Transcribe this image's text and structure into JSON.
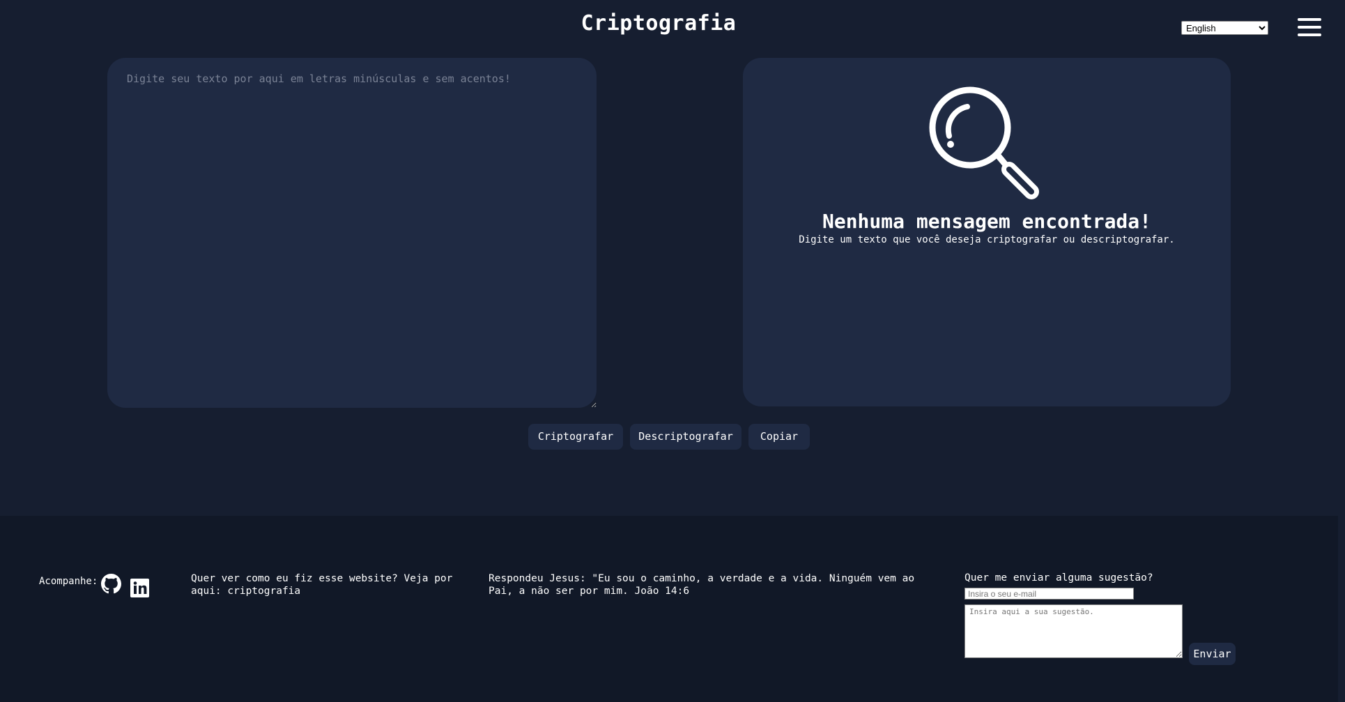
{
  "header": {
    "title": "Criptografia",
    "language_selected": "English",
    "language_options": [
      "English"
    ],
    "menu_icon": "hamburger-menu-icon"
  },
  "input": {
    "placeholder": "Digite seu texto por aqui em letras minúsculas e sem acentos!",
    "value": ""
  },
  "output": {
    "icon": "magnifier-icon",
    "title": "Nenhuma mensagem encontrada!",
    "subtitle": "Digite um texto que você deseja criptografar ou descriptografar."
  },
  "actions": {
    "encrypt_label": "Criptografar",
    "decrypt_label": "Descriptografar",
    "copy_label": "Copiar"
  },
  "footer": {
    "follow_label": "Acompanhe:",
    "social_icons": [
      "github-icon",
      "linkedin-icon"
    ],
    "repo_text": "Quer ver como eu fiz esse website? Veja por aqui: criptografia",
    "quote": "Respondeu Jesus: \"Eu sou o caminho, a verdade e a vida. Ninguém vem ao Pai, a não ser por mim. João 14:6",
    "suggestion_title": "Quer me enviar alguma sugestão?",
    "email_placeholder": "Insira o seu e-mail",
    "suggestion_placeholder": "Insira aqui a sua sugestão.",
    "send_label": "Enviar"
  },
  "colors": {
    "background": "#161e30",
    "panel": "#1f2a43",
    "footer": "#111827",
    "text": "#ffffff"
  }
}
